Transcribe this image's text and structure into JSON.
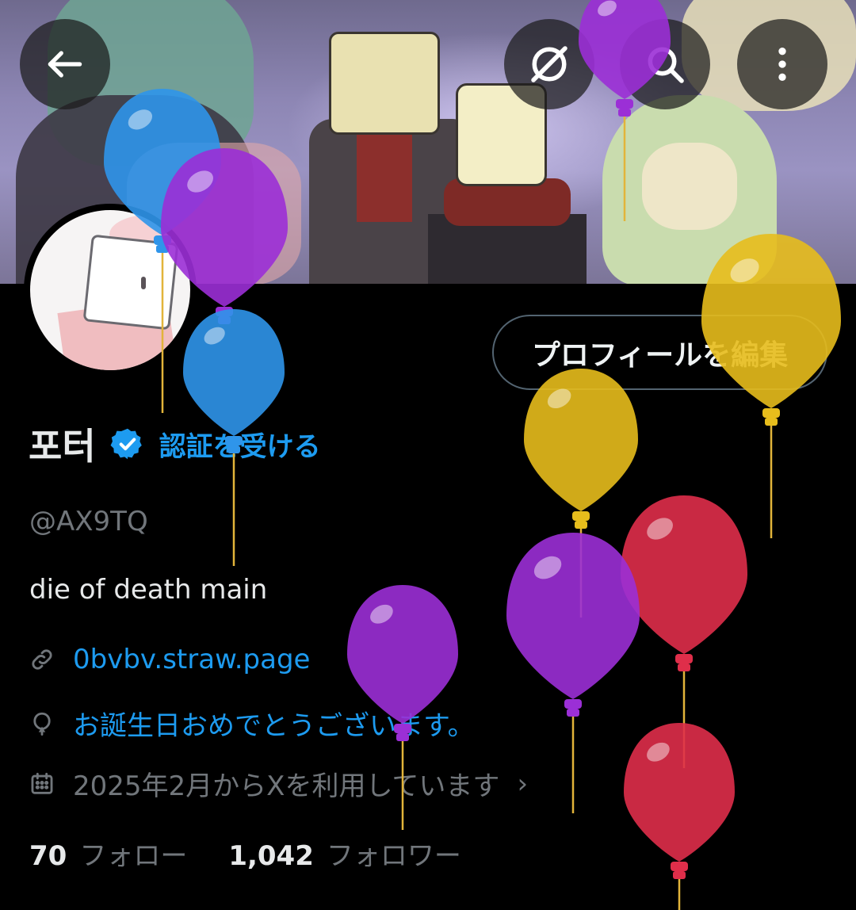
{
  "header": {
    "back_icon": "arrow-left-icon",
    "grok_icon": "grok-icon",
    "search_icon": "search-icon",
    "more_icon": "more-vertical-icon"
  },
  "profile": {
    "name": "포터",
    "get_verified_label": "認証を受ける",
    "handle": "@AX9TQ",
    "bio": "die of death main",
    "link": "0bvbv.straw.page",
    "birthday": "お誕生日おめでとうございます。",
    "joined": "2025年2月からXを利用しています",
    "joined_chevron": "›",
    "edit_profile_label": "プロフィールを編集"
  },
  "stats": {
    "following_count": "70",
    "following_label": "フォロー",
    "followers_count": "1,042",
    "followers_label": "フォロワー"
  },
  "colors": {
    "accent": "#1d9bf0",
    "secondary_text": "#71767b",
    "primary_text": "#e7e9ea",
    "background": "#000000"
  },
  "balloons": [
    {
      "color": "#2f95ea"
    },
    {
      "color": "#9b2fd6"
    },
    {
      "color": "#2f95ea"
    },
    {
      "color": "#9b2fd6"
    },
    {
      "color": "#e7bd1c"
    },
    {
      "color": "#e7bd1c"
    },
    {
      "color": "#df2e4a"
    },
    {
      "color": "#9b2fd6"
    },
    {
      "color": "#9b2fd6"
    },
    {
      "color": "#df2e4a"
    }
  ]
}
